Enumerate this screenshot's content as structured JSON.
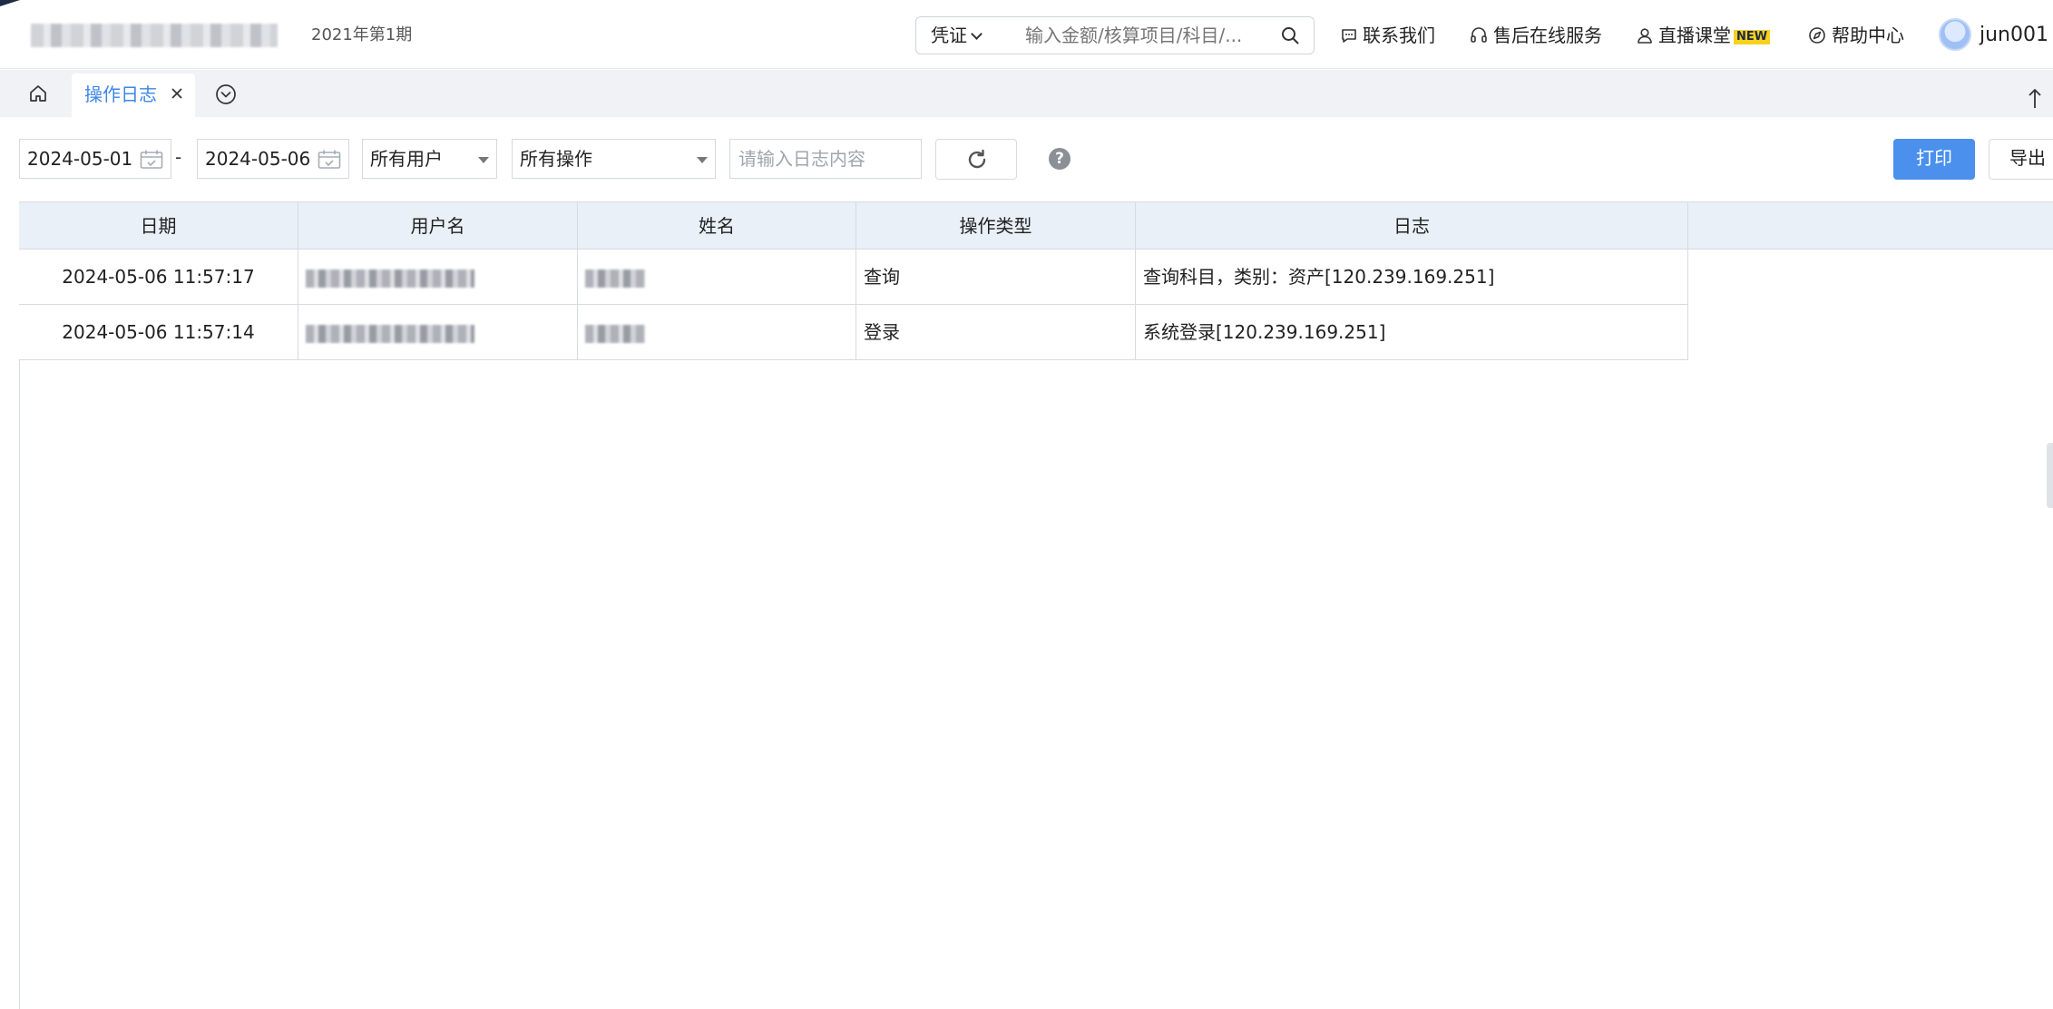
{
  "header": {
    "period": "2021年第1期",
    "search": {
      "type_label": "凭证",
      "placeholder": "输入金额/核算项目/科目/..."
    },
    "links": {
      "contact": "联系我们",
      "service": "售后在线服务",
      "live_class": "直播课堂",
      "live_badge": "NEW",
      "help": "帮助中心"
    },
    "user": {
      "name": "jun001"
    }
  },
  "tabs": {
    "active_label": "操作日志"
  },
  "filters": {
    "start_date": "2024-05-01",
    "date_separator": "-",
    "end_date": "2024-05-06",
    "user_select": "所有用户",
    "operation_select": "所有操作",
    "log_placeholder": "请输入日志内容",
    "help_glyph": "?",
    "print_label": "打印",
    "export_label": "导出"
  },
  "table": {
    "columns": [
      "日期",
      "用户名",
      "姓名",
      "操作类型",
      "日志"
    ],
    "rows": [
      {
        "date": "2024-05-06 11:57:17",
        "type": "查询",
        "log": "查询科目，类别：资产[120.239.169.251]"
      },
      {
        "date": "2024-05-06 11:57:14",
        "type": "登录",
        "log": "系统登录[120.239.169.251]"
      }
    ]
  },
  "colors": {
    "accent": "#4a90ec",
    "tab_active_text": "#3d86e8",
    "header_row_bg": "#eaf0f8",
    "tabbar_bg": "#f0f2f5",
    "new_badge_bg": "#f7d11e"
  }
}
